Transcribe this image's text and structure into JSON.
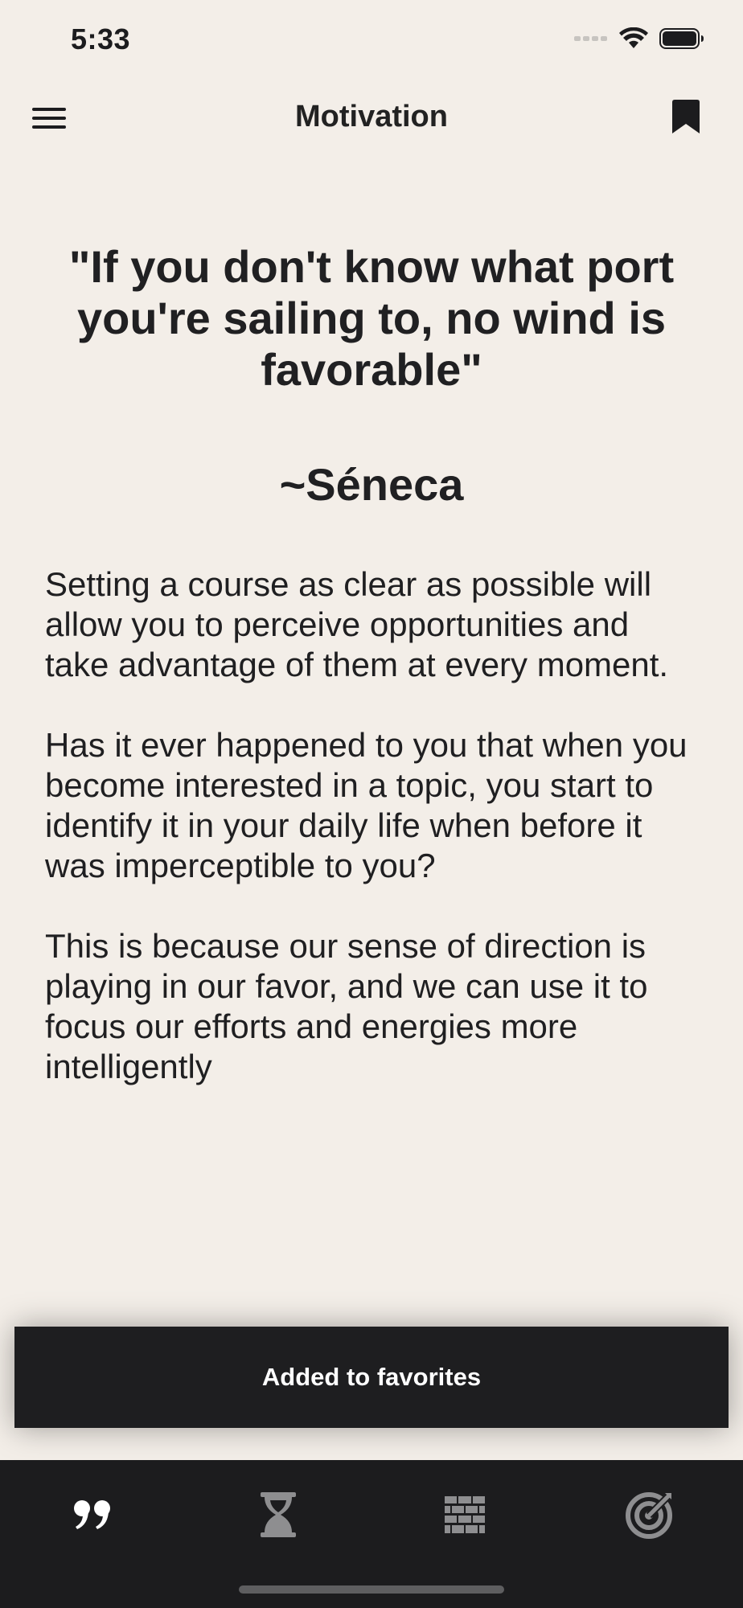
{
  "status_bar": {
    "time": "5:33"
  },
  "nav": {
    "title": "Motivation",
    "menu_icon": "hamburger-menu-icon",
    "bookmark_icon": "bookmark-icon"
  },
  "quote": {
    "text": "\"If you don't know what port you're sailing to, no wind is favorable\"",
    "author": "~Séneca"
  },
  "body": {
    "paragraphs": [
      "Setting a course as clear as possible will allow you to perceive opportunities and take advantage of them at every moment.",
      "Has it ever happened to you that when you become interested in a topic, you start to identify it in your daily life when before it was imperceptible to you?",
      "This is because our sense of direction is playing in our favor, and we can use it to focus our efforts and energies more intelligently"
    ]
  },
  "toast": {
    "message": "Added to favorites"
  },
  "tabs": [
    {
      "icon": "quote-icon",
      "active": true
    },
    {
      "icon": "hourglass-icon",
      "active": false
    },
    {
      "icon": "brick-wall-icon",
      "active": false
    },
    {
      "icon": "target-icon",
      "active": false
    }
  ],
  "colors": {
    "background": "#f3eee8",
    "text": "#1c1c1e",
    "toast_background": "#1e1e20",
    "tab_bar_background": "#1c1c1e",
    "tab_active": "#ffffff",
    "tab_inactive": "#8e8e90"
  }
}
